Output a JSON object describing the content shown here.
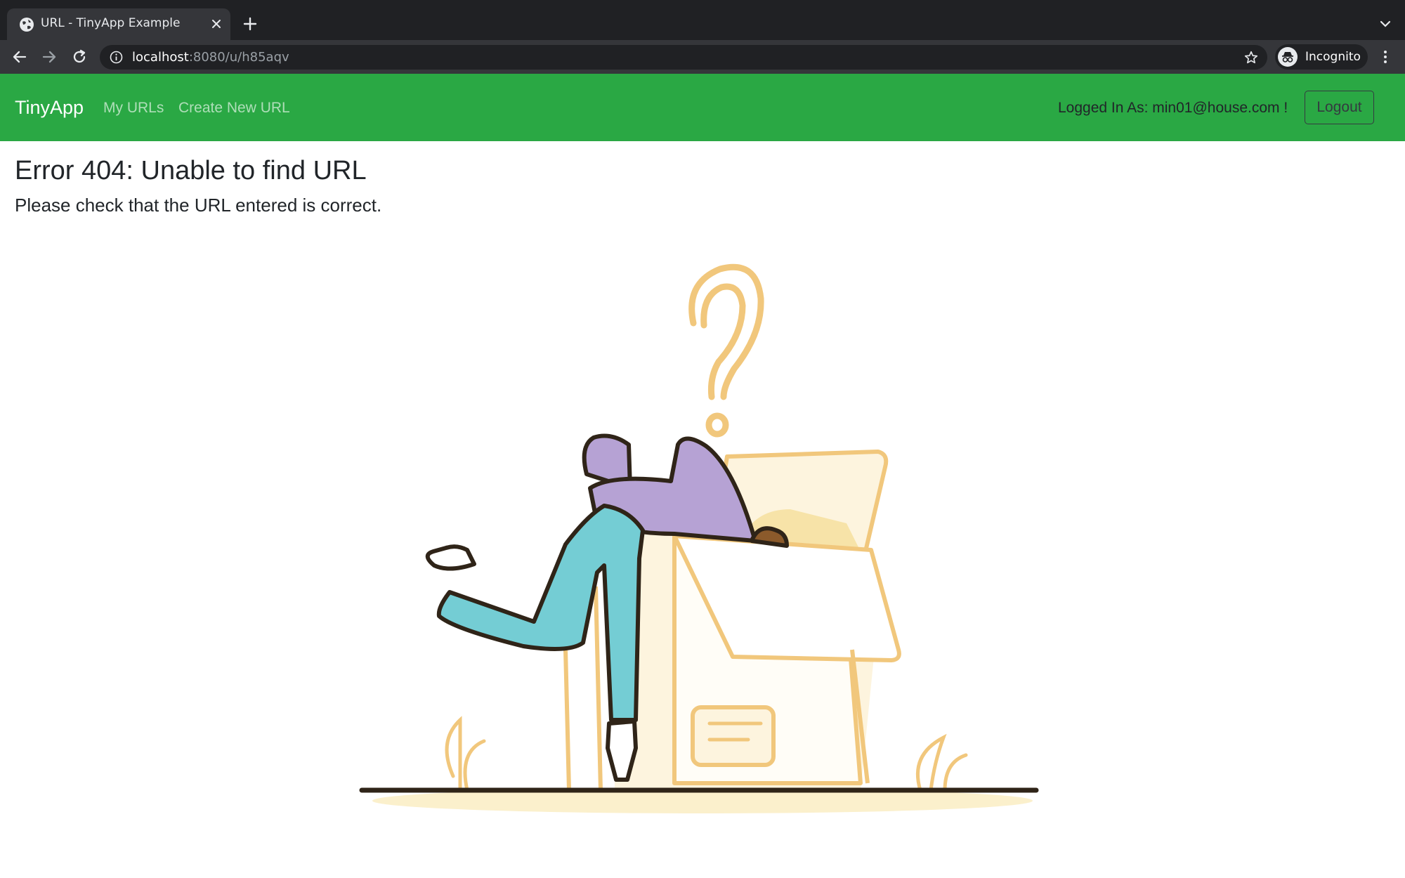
{
  "browser": {
    "tab": {
      "title": "URL - TinyApp Example"
    },
    "address": {
      "host": "localhost",
      "path": ":8080/u/h85aqv"
    },
    "profile": {
      "label": "Incognito"
    },
    "icons": {
      "favicon": "globe-icon",
      "close": "close-icon",
      "new_tab": "plus-icon",
      "tab_search": "chevron-down-icon",
      "back": "arrow-left-icon",
      "forward": "arrow-right-icon",
      "reload": "reload-icon",
      "site_info": "info-icon",
      "bookmark": "star-icon",
      "incognito": "incognito-icon",
      "menu": "kebab-menu-icon"
    }
  },
  "navbar": {
    "brand": "TinyApp",
    "links": [
      {
        "label": "My URLs"
      },
      {
        "label": "Create New URL"
      }
    ],
    "user_text": "Logged In As: min01@house.com !",
    "logout_label": "Logout",
    "background_color": "#2aa844"
  },
  "main": {
    "title": "Error 404: Unable to find URL",
    "subtitle": "Please check that the URL entered is correct.",
    "illustration": "person-searching-in-box-with-question-mark"
  }
}
